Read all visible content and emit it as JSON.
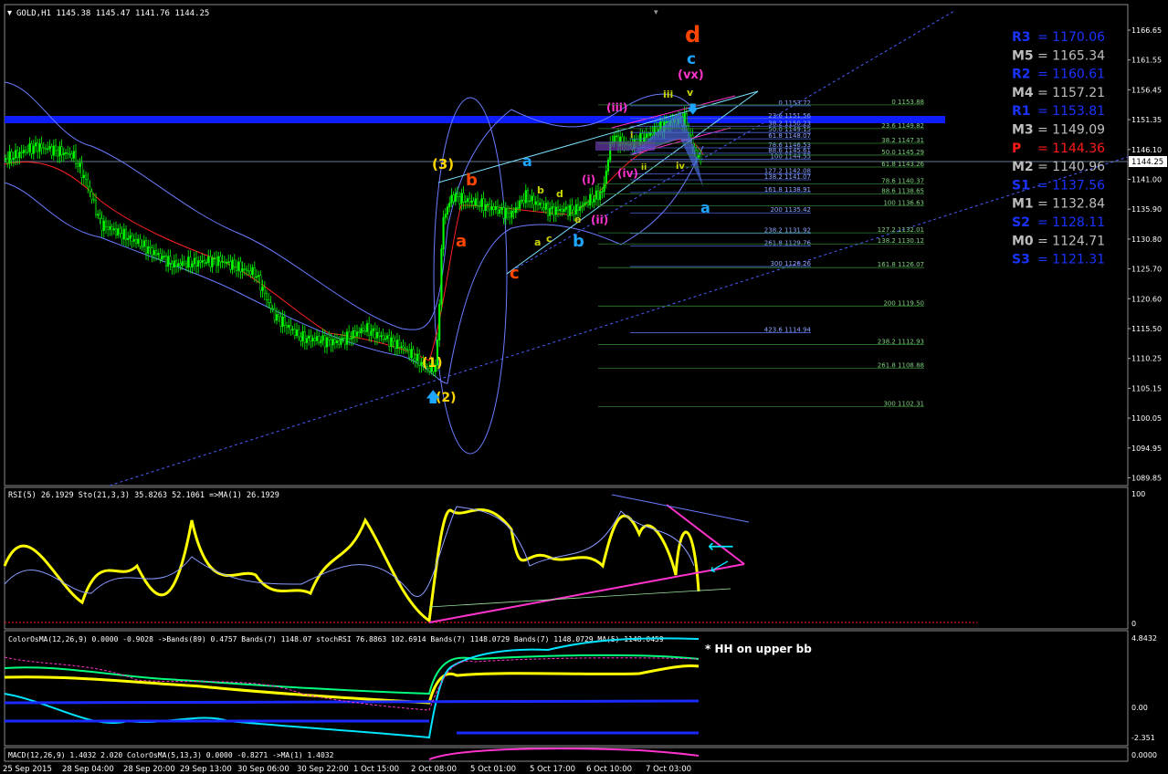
{
  "header": {
    "symbol_info": "GOLD,H1  1145.38 1145.47 1141.76 1144.25",
    "current_price": "1144.25"
  },
  "colors": {
    "background": "#000000",
    "up_candle": "#00ff00",
    "bollinger": "#6b7cff",
    "channel": "#4b5cff",
    "resistance_band": "#0d1fff",
    "rsi_line": "#ffff00",
    "trend_magenta": "#ff33cc",
    "arrow_cyan": "#00e5ff"
  },
  "main_panel": {
    "price_axis": [
      "1166.65",
      "1161.55",
      "1156.45",
      "1151.35",
      "1146.10",
      "1141.00",
      "1135.90",
      "1130.80",
      "1125.70",
      "1120.60",
      "1115.50",
      "1110.25",
      "1105.15",
      "1100.05",
      "1094.95",
      "1089.85"
    ],
    "wave_labels": [
      {
        "text": "d",
        "color": "#ff4500"
      },
      {
        "text": "c",
        "color": "#1ea5ff"
      },
      {
        "text": "(vx)",
        "color": "#ff33cc"
      },
      {
        "text": "iii",
        "color": "#c8d400"
      },
      {
        "text": "v",
        "color": "#c8d400"
      },
      {
        "text": "(iii)",
        "color": "#ff33cc"
      },
      {
        "text": "i",
        "color": "#c8d400"
      },
      {
        "text": "ii",
        "color": "#c8d400"
      },
      {
        "text": "iv",
        "color": "#c8d400"
      },
      {
        "text": "(iv)",
        "color": "#ff33cc"
      },
      {
        "text": "(i)",
        "color": "#ff33cc"
      },
      {
        "text": "(ii)",
        "color": "#ff33cc"
      },
      {
        "text": "a",
        "color": "#1ea5ff"
      },
      {
        "text": "a",
        "color": "#1ea5ff"
      },
      {
        "text": "b",
        "color": "#1ea5ff"
      },
      {
        "text": "b",
        "color": "#c8d400"
      },
      {
        "text": "d",
        "color": "#c8d400"
      },
      {
        "text": "a",
        "color": "#c8d400"
      },
      {
        "text": "c",
        "color": "#c8d400"
      },
      {
        "text": "e",
        "color": "#c8d400"
      },
      {
        "text": "(3)",
        "color": "#ffd700"
      },
      {
        "text": "b",
        "color": "#ff4500"
      },
      {
        "text": "a",
        "color": "#ff4500"
      },
      {
        "text": "c",
        "color": "#ff4500"
      },
      {
        "text": "(1)",
        "color": "#ffd700"
      },
      {
        "text": "(2)",
        "color": "#ffd700"
      }
    ],
    "fib_levels_a": [
      "0 1153.72",
      "23.6 1151.56",
      "38.2 1150.23",
      "50.0 1149.15",
      "61.8 1148.07",
      "78.6 1146.53",
      "88.6 1145.61",
      "100 1144.55",
      "127.2 1142.08",
      "138.2 1141.07",
      "161.8 1138.91",
      "200 1135.42",
      "238.2 1131.92",
      "261.8 1129.76",
      "300 1126.26",
      "423.6 1114.94"
    ],
    "fib_levels_b": [
      "0 1153.88",
      "23.6 1149.82",
      "38.2 1147.31",
      "50.0 1145.29",
      "61.8 1143.26",
      "78.6 1140.37",
      "88.6 1138.65",
      "100 1136.63",
      "127.2 1132.01",
      "138.2 1130.12",
      "161.8 1126.07",
      "200 1119.50",
      "238.2 1112.93",
      "261.8 1108.88",
      "300 1102.31"
    ],
    "pivots": [
      {
        "label": "R3",
        "value": "1170.06",
        "color": "#1a33ff"
      },
      {
        "label": "M5",
        "value": "1165.34",
        "color": "#bdbdbd"
      },
      {
        "label": "R2",
        "value": "1160.61",
        "color": "#1a33ff"
      },
      {
        "label": "M4",
        "value": "1157.21",
        "color": "#bdbdbd"
      },
      {
        "label": "R1",
        "value": "1153.81",
        "color": "#1a33ff"
      },
      {
        "label": "M3",
        "value": "1149.09",
        "color": "#bdbdbd"
      },
      {
        "label": "P",
        "value": "1144.36",
        "color": "#ff1a1a"
      },
      {
        "label": "M2",
        "value": "1140.96",
        "color": "#bdbdbd"
      },
      {
        "label": "S1",
        "value": "1137.56",
        "color": "#1a33ff"
      },
      {
        "label": "M1",
        "value": "1132.84",
        "color": "#bdbdbd"
      },
      {
        "label": "S2",
        "value": "1128.11",
        "color": "#1a33ff"
      },
      {
        "label": "M0",
        "value": "1124.71",
        "color": "#bdbdbd"
      },
      {
        "label": "S3",
        "value": "1121.31",
        "color": "#1a33ff"
      }
    ]
  },
  "rsi_panel": {
    "title": "RSI(5) 26.1929  Sto(21,3,3) 35.8263 52.1061  =>MA(1) 26.1929",
    "axis": [
      "100",
      "0"
    ]
  },
  "osma_panel": {
    "title": "ColorOsMA(12,26,9) 0.0000 -0.9028  ->Bands(89) 0.4757  Bands(7) 1148.07  stochRSI 76.8863 102.6914  Bands(7) 1148.0729  Bands(7) 1148.0729  MA(5) 1148.0459",
    "axis": [
      "4.8432",
      "0.00",
      "-2.351"
    ],
    "note": "* HH on upper bb"
  },
  "macd_panel": {
    "title": "MACD(12,26,9) 1.4032 2.020  ColorOsMA(5,13,3) 0.0000 -0.8271  ->MA(1) 1.4032",
    "axis": "0.0000"
  },
  "time_axis": [
    "25 Sep 2015",
    "28 Sep 04:00",
    "28 Sep 20:00",
    "29 Sep 13:00",
    "30 Sep 06:00",
    "30 Sep 22:00",
    "1 Oct 15:00",
    "2 Oct 08:00",
    "5 Oct 01:00",
    "5 Oct 17:00",
    "6 Oct 10:00",
    "7 Oct 03:00"
  ],
  "chart_data": {
    "type": "candlestick",
    "symbol": "GOLD",
    "timeframe": "H1",
    "ylim": [
      1089.85,
      1166.65
    ],
    "x": [
      "25 Sep 2015",
      "28 Sep 04:00",
      "28 Sep 20:00",
      "29 Sep 13:00",
      "30 Sep 06:00",
      "30 Sep 22:00",
      "1 Oct 15:00",
      "2 Oct 08:00",
      "5 Oct 01:00",
      "5 Oct 17:00",
      "6 Oct 10:00",
      "7 Oct 03:00"
    ],
    "close_approx": [
      1146.5,
      1140.0,
      1129.5,
      1127.5,
      1114.5,
      1114.0,
      1113.5,
      1106.0,
      1140.5,
      1138.5,
      1147.5,
      1144.25
    ],
    "last": {
      "open": 1145.38,
      "high": 1145.47,
      "low": 1141.76,
      "close": 1144.25
    },
    "horizontal_band": 1151.6
  }
}
